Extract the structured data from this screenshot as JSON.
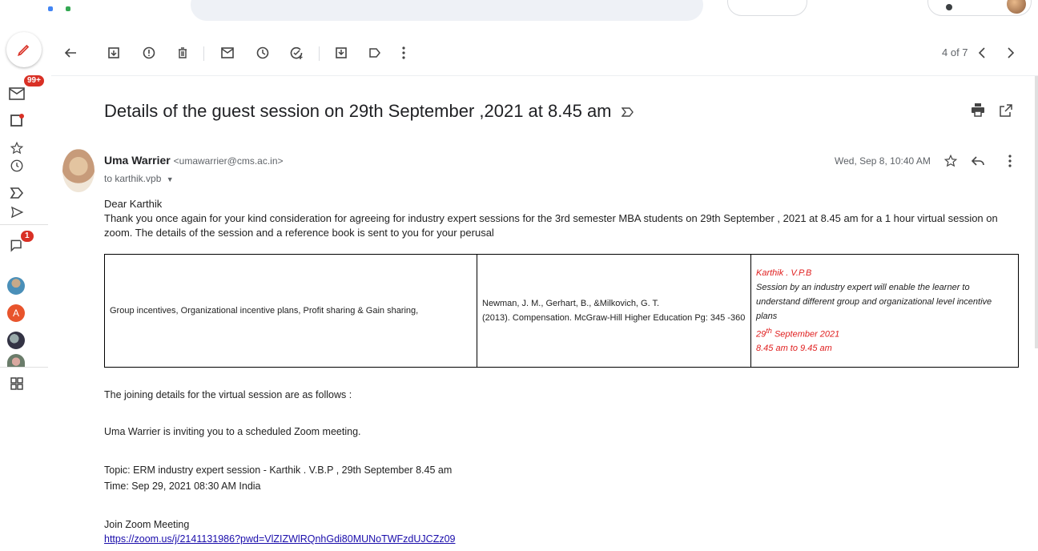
{
  "toolbar": {
    "pager": "4 of 7"
  },
  "rail": {
    "inbox_badge": "99+",
    "chat_badge": "1",
    "contact_initial": "A"
  },
  "email": {
    "subject": "Details of the guest session on 29th September ,2021 at 8.45 am",
    "sender_name": "Uma Warrier",
    "sender_email": "<umawarrier@cms.ac.in>",
    "to": "to karthik.vpb",
    "date": "Wed, Sep 8, 10:40 AM",
    "greeting": "Dear Karthik",
    "para1": "Thank you once again for your kind consideration for agreeing for industry expert sessions for the 3rd semester MBA students on 29th September , 2021 at 8.45 am for a 1 hour virtual session on zoom. The details of the session and a reference book is sent to you for your perusal",
    "table": {
      "topic": "Group incentives, Organizational incentive plans, Profit sharing & Gain sharing,",
      "reference_line1": "Newman, J. M., Gerhart, B., &Milkovich, G. T.",
      "reference_line2": "(2013). Compensation. McGraw-Hill Higher Education Pg: 345 -360",
      "speaker": "Karthik  . V.P.B",
      "description": "Session by an industry expert will enable the learner to understand different group and organizational level incentive plans",
      "date_day": "29",
      "date_suffix": "th",
      "date_rest": " September 2021",
      "time": "8.45 am to 9.45 am"
    },
    "joining": "The joining details for the virtual session are as follows :",
    "inviting": "Uma Warrier is inviting you to a scheduled Zoom meeting.",
    "topic_line": "Topic: ERM industry expert session - Karthik . V.B.P , 29th September 8.45 am",
    "time_line": "Time: Sep 29, 2021 08:30 AM India",
    "join_label": "Join Zoom Meeting",
    "join_link": "https://zoom.us/j/2141131986?pwd=VlZIZWlRQnhGdi80MUNoTWFzdUJCZz09"
  }
}
